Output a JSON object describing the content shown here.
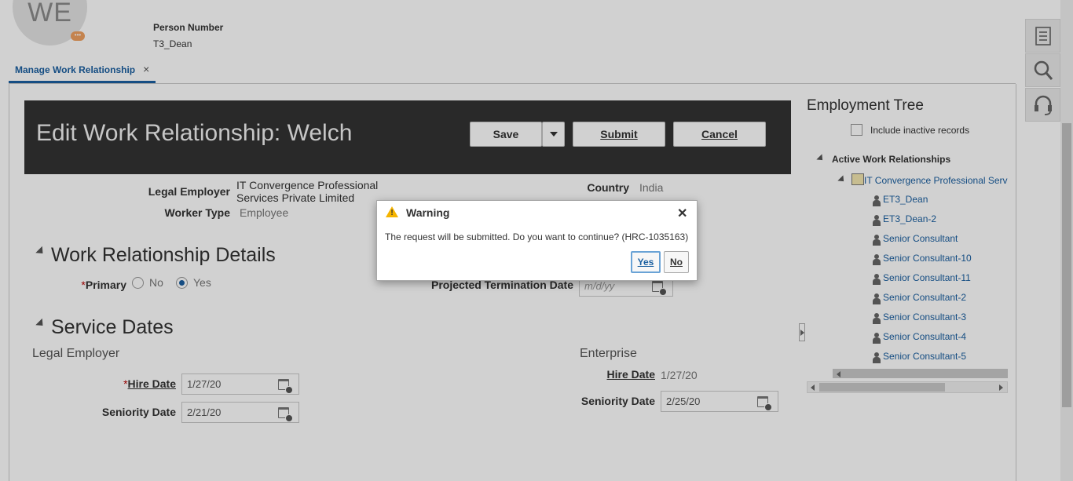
{
  "header": {
    "avatar_initials": "WE",
    "avatar_badge": "•••",
    "person_number_label": "Person Number",
    "person_number_value": "T3_Dean"
  },
  "tab": {
    "label": "Manage Work Relationship",
    "close": "×"
  },
  "banner": {
    "title": "Edit Work Relationship: Welch",
    "save_label": "Save",
    "submit_label": "Submit",
    "cancel_label": "Cancel"
  },
  "details": {
    "legal_employer_label": "Legal Employer",
    "legal_employer_value_line1": "IT Convergence Professional",
    "legal_employer_value_line2": "Services Private Limited",
    "worker_type_label": "Worker Type",
    "worker_type_value": "Employee",
    "country_label": "Country",
    "country_value": "India"
  },
  "work_relationship": {
    "section_title": "Work Relationship Details",
    "primary_required": "*",
    "primary_label": "Primary",
    "option_no": "No",
    "option_yes": "Yes",
    "selected": "Yes",
    "projected_termination_label": "Projected Termination Date",
    "projected_termination_placeholder": "m/d/yy"
  },
  "service_dates": {
    "section_title": "Service Dates",
    "legal_employer_heading": "Legal Employer",
    "enterprise_heading": "Enterprise",
    "hire_date_required": "*",
    "hire_date_label": "Hire Date",
    "hire_date_value": "1/27/20",
    "seniority_date_label": "Seniority Date",
    "seniority_date_value": "2/21/20",
    "ent_hire_date_label": "Hire Date",
    "ent_hire_date_value": "1/27/20",
    "ent_seniority_date_label": "Seniority Date",
    "ent_seniority_date_value": "2/25/20"
  },
  "employment_tree": {
    "title": "Employment Tree",
    "include_inactive_label": "Include inactive records",
    "root_label": "Active Work Relationships",
    "org_label": "IT Convergence Professional Serv",
    "items": [
      "ET3_Dean",
      "ET3_Dean-2",
      "Senior Consultant",
      "Senior Consultant-10",
      "Senior Consultant-11",
      "Senior Consultant-2",
      "Senior Consultant-3",
      "Senior Consultant-4",
      "Senior Consultant-5"
    ]
  },
  "dialog": {
    "title": "Warning",
    "close": "✕",
    "message": "The request will be submitted. Do you want to continue? (HRC-1035163)",
    "yes_label": "Yes",
    "no_label": "No"
  },
  "tools": [
    "tasks-icon",
    "search-icon",
    "headset-icon"
  ],
  "colors": {
    "accent": "#1a5fa0",
    "banner": "#333333",
    "warning": "#f5b400"
  }
}
